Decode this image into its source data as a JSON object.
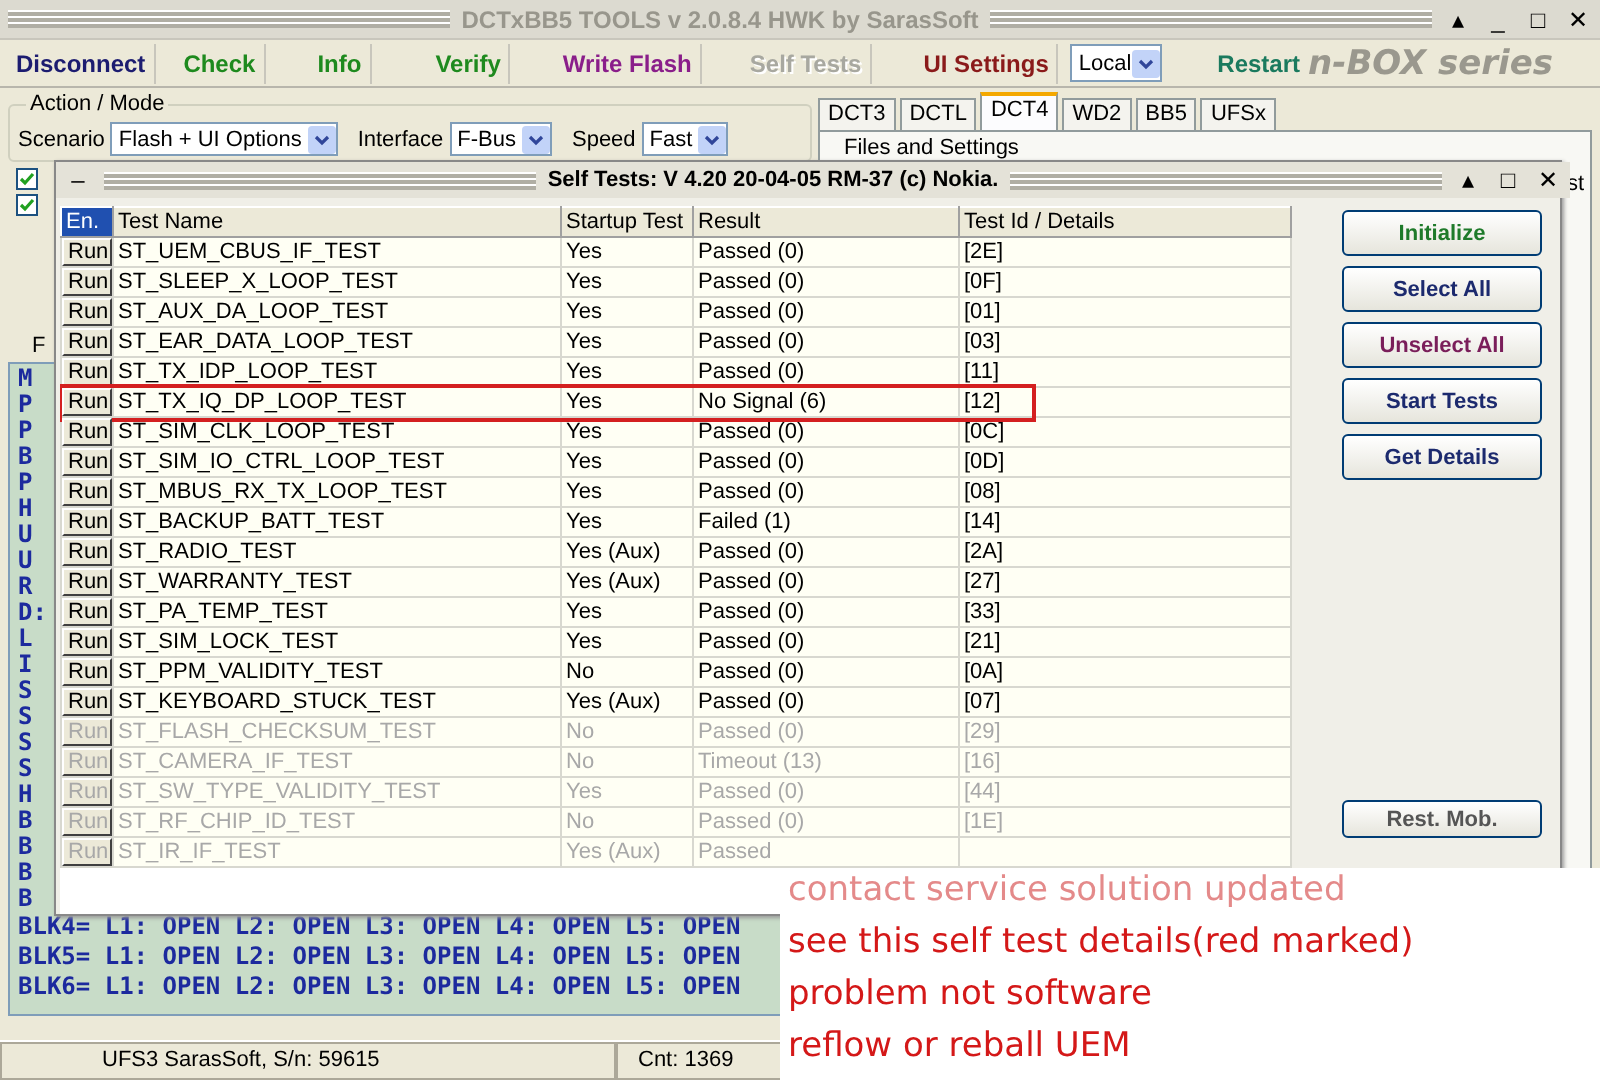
{
  "window": {
    "title": "DCTxBB5 TOOLS v 2.0.8.4 HWK by SarasSoft",
    "controls": [
      "▴",
      "_",
      "□",
      "✕"
    ]
  },
  "toolbar": [
    {
      "label": "Disconnect",
      "color": "#1c1c70",
      "disabled": false
    },
    {
      "label": "Check",
      "color": "#1e8a1e",
      "disabled": false
    },
    {
      "label": "Info",
      "color": "#1e8a1e",
      "disabled": false
    },
    {
      "label": "Verify",
      "color": "#1e8a1e",
      "disabled": false
    },
    {
      "label": "Write Flash",
      "color": "#8a1e8a",
      "disabled": false
    },
    {
      "label": "Self Tests",
      "color": "#a8a8a0",
      "disabled": true
    },
    {
      "label": "UI Settings",
      "color": "#8a1a1a",
      "disabled": false
    }
  ],
  "port_select": {
    "value": "Local"
  },
  "restart": {
    "label": "Restart",
    "color": "#1a7a5e"
  },
  "logo": "n-BOX series",
  "action_mode": {
    "title": "Action / Mode",
    "fields": [
      {
        "label": "Scenario",
        "value": "Flash + UI Options"
      },
      {
        "label": "Interface",
        "value": "F-Bus"
      },
      {
        "label": "Speed",
        "value": "Fast"
      }
    ]
  },
  "options": [
    {
      "checked": true
    },
    {
      "checked": true
    }
  ],
  "left_label": "F",
  "log": {
    "fragments": [
      "M",
      "P",
      "P",
      "B",
      "P",
      "H",
      "U",
      "U",
      "R",
      "D:",
      "L",
      "I",
      "S",
      "S",
      "S",
      "S",
      "H",
      "B",
      "B",
      "B",
      "B"
    ],
    "lines": [
      "BLK4= L1: OPEN L2: OPEN L3: OPEN L4: OPEN L5: OPEN",
      "BLK5= L1: OPEN L2: OPEN L3: OPEN L4: OPEN L5: OPEN",
      "BLK6= L1: OPEN L2: OPEN L3: OPEN L4: OPEN L5: OPEN"
    ]
  },
  "tabs": [
    {
      "label": "DCT3",
      "selected": false
    },
    {
      "label": "DCTL",
      "selected": false
    },
    {
      "label": "DCT4",
      "selected": true
    },
    {
      "label": "WD2",
      "selected": false
    },
    {
      "label": "BB5",
      "selected": false
    },
    {
      "label": "UFSx",
      "selected": false
    }
  ],
  "files_group": {
    "title": "Files and Settings",
    "cut_text": "st"
  },
  "self_tests": {
    "title": "Self Tests: V 4.20 20-04-05 RM-37 (c) Nokia.",
    "menu": "–",
    "controls": [
      "▴",
      "□",
      "✕"
    ],
    "columns": [
      "En.",
      "Test Name",
      "Startup Test",
      "Result",
      "Test Id / Details"
    ],
    "rows": [
      {
        "run": "Run",
        "name": "ST_UEM_CBUS_IF_TEST",
        "startup": "Yes",
        "result": "Passed (0)",
        "details": "[2E]",
        "disabled": false,
        "highlighted": false
      },
      {
        "run": "Run",
        "name": "ST_SLEEP_X_LOOP_TEST",
        "startup": "Yes",
        "result": "Passed (0)",
        "details": "[0F]",
        "disabled": false,
        "highlighted": false
      },
      {
        "run": "Run",
        "name": "ST_AUX_DA_LOOP_TEST",
        "startup": "Yes",
        "result": "Passed (0)",
        "details": "[01]",
        "disabled": false,
        "highlighted": false
      },
      {
        "run": "Run",
        "name": "ST_EAR_DATA_LOOP_TEST",
        "startup": "Yes",
        "result": "Passed (0)",
        "details": "[03]",
        "disabled": false,
        "highlighted": false
      },
      {
        "run": "Run",
        "name": "ST_TX_IDP_LOOP_TEST",
        "startup": "Yes",
        "result": "Passed (0)",
        "details": "[11]",
        "disabled": false,
        "highlighted": false
      },
      {
        "run": "Run",
        "name": "ST_TX_IQ_DP_LOOP_TEST",
        "startup": "Yes",
        "result": "No Signal (6)",
        "details": "[12]",
        "disabled": false,
        "highlighted": true
      },
      {
        "run": "Run",
        "name": "ST_SIM_CLK_LOOP_TEST",
        "startup": "Yes",
        "result": "Passed (0)",
        "details": "[0C]",
        "disabled": false,
        "highlighted": false
      },
      {
        "run": "Run",
        "name": "ST_SIM_IO_CTRL_LOOP_TEST",
        "startup": "Yes",
        "result": "Passed (0)",
        "details": "[0D]",
        "disabled": false,
        "highlighted": false
      },
      {
        "run": "Run",
        "name": "ST_MBUS_RX_TX_LOOP_TEST",
        "startup": "Yes",
        "result": "Passed (0)",
        "details": "[08]",
        "disabled": false,
        "highlighted": false
      },
      {
        "run": "Run",
        "name": "ST_BACKUP_BATT_TEST",
        "startup": "Yes",
        "result": "Failed (1)",
        "details": "[14]",
        "disabled": false,
        "highlighted": false
      },
      {
        "run": "Run",
        "name": "ST_RADIO_TEST",
        "startup": "Yes (Aux)",
        "result": "Passed (0)",
        "details": "[2A]",
        "disabled": false,
        "highlighted": false
      },
      {
        "run": "Run",
        "name": "ST_WARRANTY_TEST",
        "startup": "Yes (Aux)",
        "result": "Passed (0)",
        "details": "[27]",
        "disabled": false,
        "highlighted": false
      },
      {
        "run": "Run",
        "name": "ST_PA_TEMP_TEST",
        "startup": "Yes",
        "result": "Passed (0)",
        "details": "[33]",
        "disabled": false,
        "highlighted": false
      },
      {
        "run": "Run",
        "name": "ST_SIM_LOCK_TEST",
        "startup": "Yes",
        "result": "Passed (0)",
        "details": "[21]",
        "disabled": false,
        "highlighted": false
      },
      {
        "run": "Run",
        "name": "ST_PPM_VALIDITY_TEST",
        "startup": "No",
        "result": "Passed (0)",
        "details": "[0A]",
        "disabled": false,
        "highlighted": false
      },
      {
        "run": "Run",
        "name": "ST_KEYBOARD_STUCK_TEST",
        "startup": "Yes (Aux)",
        "result": "Passed (0)",
        "details": "[07]",
        "disabled": false,
        "highlighted": false
      },
      {
        "run": "Run",
        "name": "ST_FLASH_CHECKSUM_TEST",
        "startup": "No",
        "result": "Passed (0)",
        "details": "[29]",
        "disabled": true,
        "highlighted": false
      },
      {
        "run": "Run",
        "name": "ST_CAMERA_IF_TEST",
        "startup": "No",
        "result": "Timeout (13)",
        "details": "[16]",
        "disabled": true,
        "highlighted": false
      },
      {
        "run": "Run",
        "name": "ST_SW_TYPE_VALIDITY_TEST",
        "startup": "Yes",
        "result": "Passed (0)",
        "details": "[44]",
        "disabled": true,
        "highlighted": false
      },
      {
        "run": "Run",
        "name": "ST_RF_CHIP_ID_TEST",
        "startup": "No",
        "result": "Passed (0)",
        "details": "[1E]",
        "disabled": true,
        "highlighted": false
      },
      {
        "run": "Run",
        "name": "ST_IR_IF_TEST",
        "startup": "Yes (Aux)",
        "result": "Passed",
        "details": "",
        "disabled": true,
        "highlighted": false
      }
    ],
    "buttons": [
      {
        "label": "Initialize",
        "color": "#1e7a2a"
      },
      {
        "label": "Select All",
        "color": "#1c2a6e"
      },
      {
        "label": "Unselect All",
        "color": "#7a1e5a"
      },
      {
        "label": "Start Tests",
        "color": "#1c2a6e"
      },
      {
        "label": "Get Details",
        "color": "#1c2a6e"
      }
    ],
    "bottom_button": "Rest. Mob."
  },
  "status_bar": [
    "UFS3 SarasSoft, S/n: 59615",
    "Cnt: 1369"
  ],
  "note": [
    {
      "text": "contact service solution updated",
      "faded": true
    },
    {
      "text": "see this self test details(red marked)",
      "faded": false
    },
    {
      "text": "problem not software",
      "faded": false
    },
    {
      "text": "reflow or reball UEM",
      "faded": false
    }
  ]
}
